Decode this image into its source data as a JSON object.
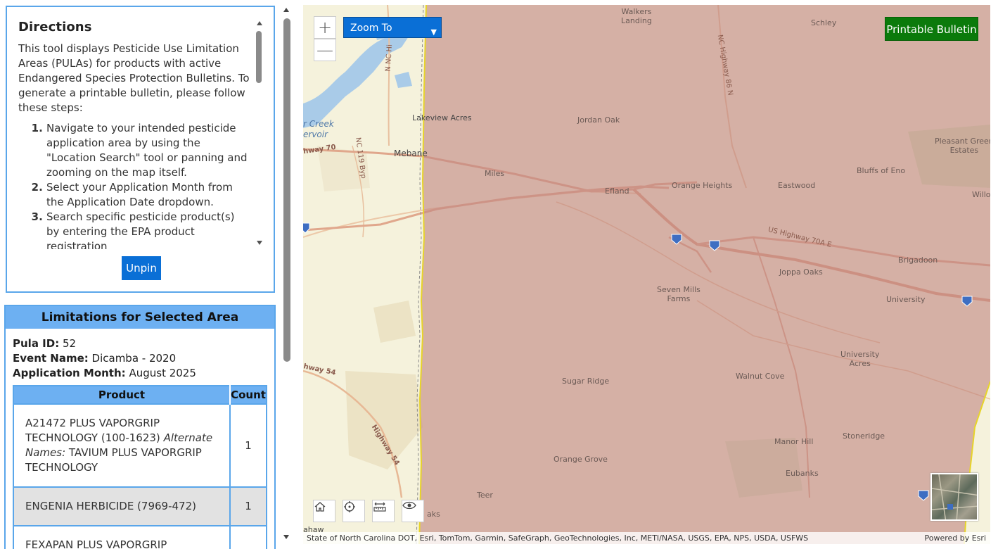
{
  "directions": {
    "title": "Directions",
    "intro": "This tool displays Pesticide Use Limitation Areas (PULAs) for products with active Endangered Species Protection Bulletins. To generate a printable bulletin, please follow these steps:",
    "steps": [
      "Navigate to your intended pesticide application area by using the \"Location Search\" tool or panning and zooming on the map itself.",
      "Select your Application Month from the Application Date dropdown.",
      "Search specific pesticide product(s) by entering the EPA product registration"
    ],
    "unpin_label": "Unpin"
  },
  "limitations": {
    "title": "Limitations for Selected Area",
    "pula_label": "Pula ID:",
    "pula_value": "52",
    "event_label": "Event Name:",
    "event_value": "Dicamba - 2020",
    "month_label": "Application Month:",
    "month_value": "August 2025",
    "table": {
      "headers": [
        "Product",
        "Count"
      ],
      "rows": [
        {
          "product": "A21472 PLUS VAPORGRIP TECHNOLOGY (100-1623)",
          "alt_label": "Alternate Names:",
          "alt_names": "TAVIUM PLUS VAPORGRIP TECHNOLOGY",
          "count": "1"
        },
        {
          "product": "ENGENIA HERBICIDE (7969-472)",
          "alt_label": "",
          "alt_names": "",
          "count": "1"
        },
        {
          "product": "FEXAPAN PLUS VAPORGRIP",
          "alt_label": "",
          "alt_names": "",
          "count": ""
        }
      ]
    }
  },
  "map": {
    "zoom_in": "+",
    "zoom_out": "—",
    "zoom_to_label": "Zoom To",
    "printable_label": "Printable Bulletin",
    "attribution": "State of North Carolina DOT, Esri, TomTom, Garmin, SafeGraph, GeoTechnologies, Inc, METI/NASA, USGS, EPA, NPS, USDA, USFWS",
    "powered_by": "Powered by Esri",
    "places": {
      "walkers_landing": "Walkers\nLanding",
      "schley": "Schley",
      "lakeview_acres": "Lakeview Acres",
      "jordan_oak": "Jordan Oak",
      "pleasant_green": "Pleasant Green\nEstates",
      "mebane": "Mebane",
      "bluffs_of_eno": "Bluffs of Eno",
      "miles": "Miles",
      "efland": "Efland",
      "orange_heights": "Orange Heights",
      "eastwood": "Eastwood",
      "willo": "Willo",
      "joppa_oaks": "Joppa Oaks",
      "brigadoon": "Brigadoon",
      "seven_mills": "Seven Mills\nFarms",
      "university": "University",
      "university_acres": "University\nAcres",
      "sugar_ridge": "Sugar Ridge",
      "walnut_cove": "Walnut Cove",
      "manor_hill": "Manor Hill",
      "stoneridge": "Stoneridge",
      "orange_grove": "Orange Grove",
      "eubanks": "Eubanks",
      "teer": "Teer",
      "oaks": "aks",
      "ahaw": "ahaw",
      "creek": "r Creek\nervoir",
      "hwy70": "hway 70",
      "hwy54": "hway 54",
      "highway54": "Highway 54",
      "nc119": "NC 119 Byp",
      "nhwy": "N NC Hi",
      "us70a": "US Highway 70A E",
      "nchwy": "NC Highway 86 N"
    }
  }
}
